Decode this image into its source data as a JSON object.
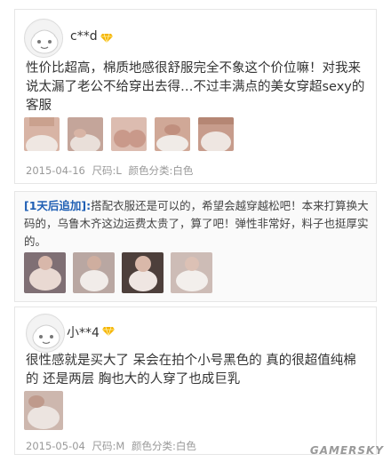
{
  "reviews": [
    {
      "username": "c**d",
      "text": "性价比超高，棉质地感很舒服完全不象这个价位嘛！对我来说太漏了老公不给穿出去得…不过丰满点的美女穿超sexy的客服",
      "photos": [
        "photo-1",
        "photo-2",
        "photo-3",
        "photo-4",
        "photo-5"
      ],
      "date": "2015-04-16",
      "size_label": "尺码:",
      "size": "L",
      "color_label": "颜色分类:",
      "color": "白色"
    },
    {
      "username": "小**4",
      "text": "很性感就是买大了 呆会在拍个小号黑色的 真的很超值纯棉的 还是两层 胸也大的人穿了也成巨乳",
      "photos": [
        "photo-1"
      ],
      "date": "2015-05-04",
      "size_label": "尺码:",
      "size": "M",
      "color_label": "颜色分类:",
      "color": "白色"
    }
  ],
  "append": {
    "tag": "[1天后追加]:",
    "text": "搭配衣服还是可以的，希望会越穿越松吧！本来打算换大码的，乌鲁木齐这边运费太贵了，算了吧！弹性非常好，料子也挺厚实的。",
    "photos": [
      "photo-1",
      "photo-2",
      "photo-3",
      "photo-4"
    ]
  },
  "watermark": "GAMERSKY",
  "colors": {
    "vip": "#f5b400",
    "append_tag": "#1f5fb4"
  }
}
